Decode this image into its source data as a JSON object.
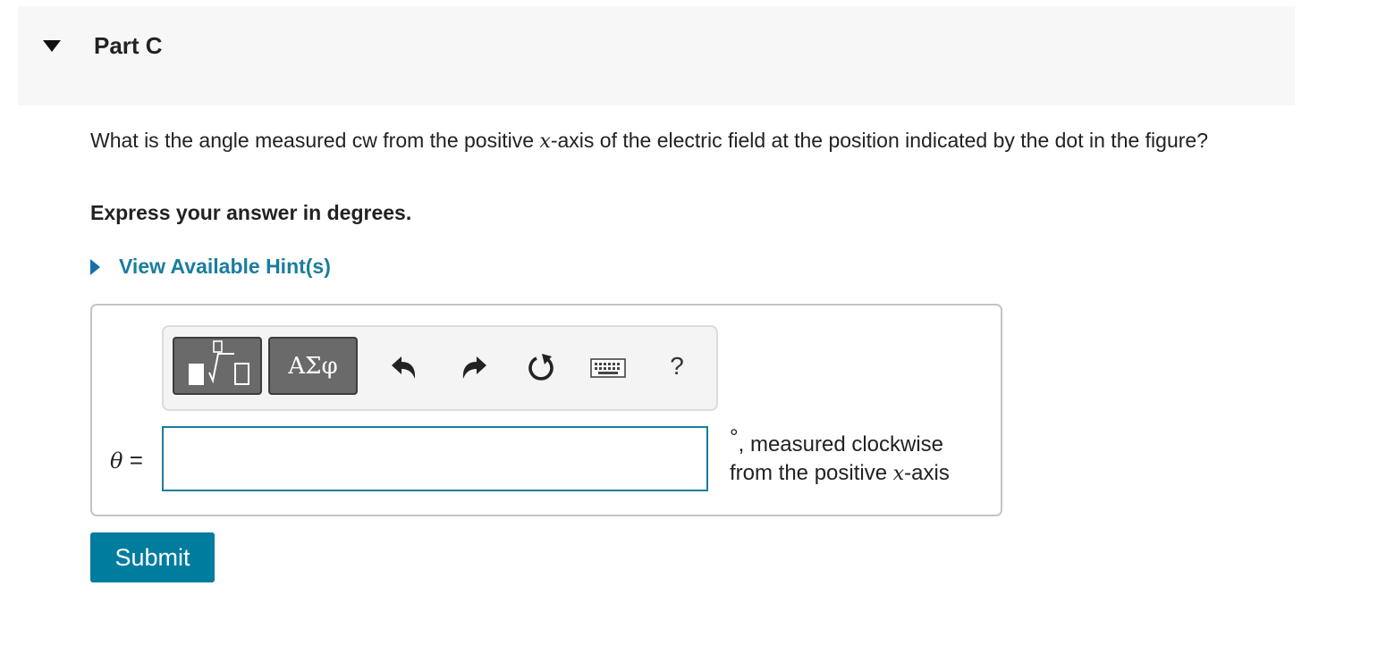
{
  "part": {
    "title": "Part C"
  },
  "question": {
    "text_before": "What is the angle measured cw from the positive ",
    "variable": "x",
    "text_after": "-axis of the electric field at the position indicated by the dot in the figure?"
  },
  "instruction": "Express your answer in degrees.",
  "hint": {
    "label": "View Available Hint(s)"
  },
  "toolbar": {
    "greek_label": "ΑΣφ",
    "help_label": "?",
    "icons": [
      "templates-icon",
      "greek-letters-icon",
      "undo-icon",
      "redo-icon",
      "reset-icon",
      "keyboard-icon",
      "help-icon"
    ]
  },
  "answer": {
    "variable": "θ",
    "equals": "=",
    "value": "",
    "unit_symbol": "°",
    "unit_text_1": ", measured clockwise",
    "unit_text_2": "from the positive ",
    "unit_variable": "x",
    "unit_text_3": "-axis"
  },
  "submit": {
    "label": "Submit"
  },
  "colors": {
    "accent": "#007c9e",
    "link": "#1a7d9d",
    "header_bg": "#f7f7f7",
    "border": "#c4c4c4"
  }
}
